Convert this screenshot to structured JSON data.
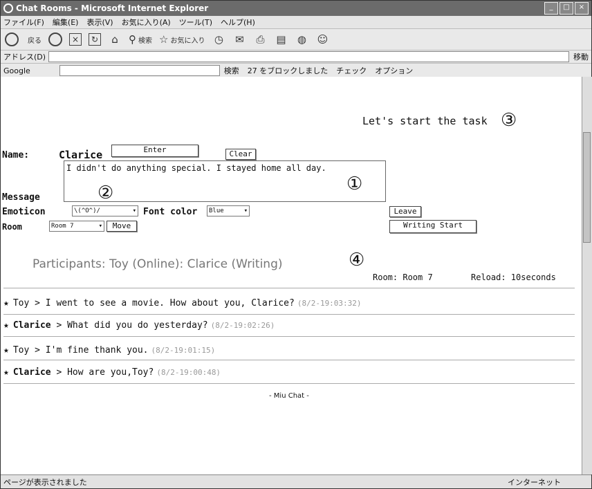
{
  "window": {
    "title": "Chat Rooms - Microsoft Internet Explorer"
  },
  "menu": [
    "ファイル(F)",
    "編集(E)",
    "表示(V)",
    "お気に入り(A)",
    "ツール(T)",
    "ヘルプ(H)"
  ],
  "toolbar": {
    "back": "戻る",
    "search": "検索",
    "favorites": "お気に入り"
  },
  "address": {
    "label": "アドレス(D)",
    "go": "移動"
  },
  "google": {
    "label": "Google",
    "search": "検索",
    "blocked": "27 をブロックしました",
    "spell": "チェック",
    "options": "オプション"
  },
  "page": {
    "task_title": "Let's start the task",
    "name_label": "Name:",
    "name_value": "Clarice",
    "enter_button": "Enter",
    "clear_button": "Clear",
    "message_label": "Message",
    "message_text": "I didn't do anything special. I stayed home all day.",
    "emoticon_label": "Emoticon",
    "emoticon_value": "\\(^O^)/",
    "font_color_label": "Font color",
    "font_color_value": "Blue",
    "leave_button": "Leave",
    "room_label": "Room",
    "room_value": "Room 7",
    "move_button": "Move",
    "writing_start_button": "Writing Start",
    "participants": "Participants: Toy (Online): Clarice (Writing)",
    "room_info": "Room: Room 7",
    "reload_info": "Reload: 10seconds",
    "footer": "- Miu Chat -",
    "markers": [
      "①",
      "②",
      "③",
      "④"
    ]
  },
  "chat": [
    {
      "user": "Toy",
      "text": "I went to see a movie. How about you, Clarice?",
      "time": "(8/2-19:03:32)"
    },
    {
      "user": "Clarice",
      "text": "What did you do yesterday?",
      "time": "(8/2-19:02:26)"
    },
    {
      "user": "Toy",
      "text": "I'm fine thank you.",
      "time": "(8/2-19:01:15)"
    },
    {
      "user": "Clarice",
      "text": "How are you,Toy?",
      "time": "(8/2-19:00:48)"
    }
  ],
  "status": {
    "left": "ページが表示されました",
    "zone": "インターネット"
  }
}
